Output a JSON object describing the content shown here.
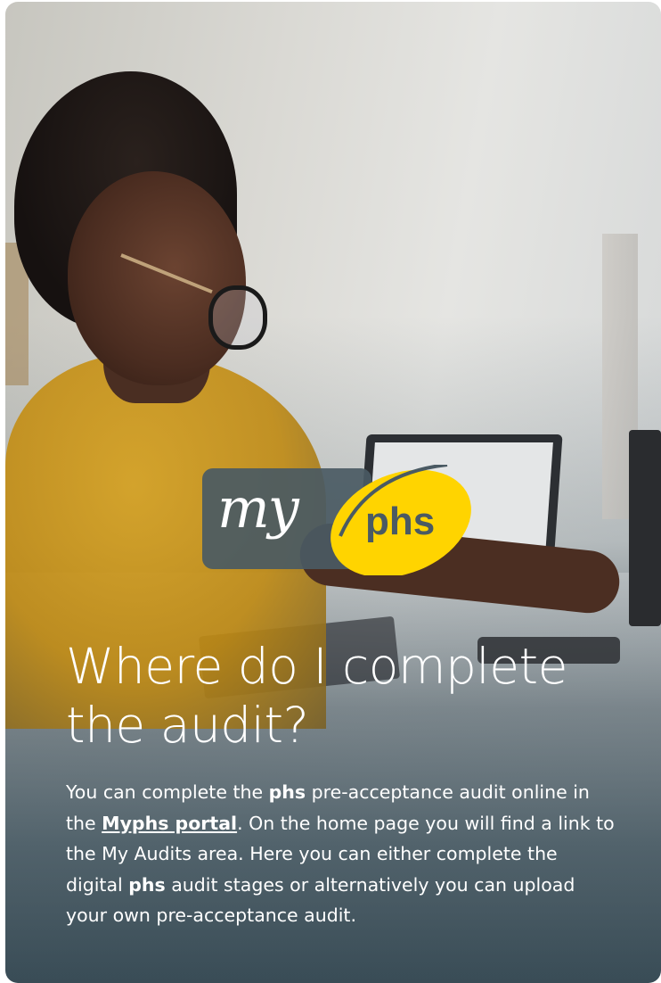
{
  "card": {
    "logo": {
      "my_text": "my",
      "phs_text": "phs"
    },
    "heading": "Where do I complete the audit?",
    "body": {
      "p1": "You can complete the ",
      "phs1": "phs",
      "p2": " pre-acceptance audit online in the ",
      "link": "Myphs portal",
      "p3": ". On the home page you will find a link to the My Audits area. Here you can either complete the digital ",
      "phs2": "phs",
      "p4": " audit stages or alternatively you can upload your own pre-acceptance audit."
    }
  },
  "colors": {
    "overlay": "#3f525c",
    "logo_plate": "#4a5a63",
    "logo_yellow": "#ffd400",
    "text": "#ffffff"
  }
}
